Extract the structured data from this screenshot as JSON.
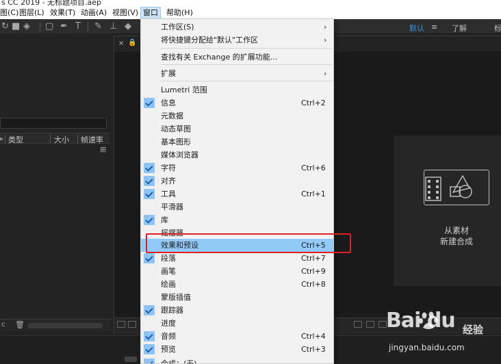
{
  "titlebar": {
    "text": "s CC 2019 - 无标题项目.aep"
  },
  "menubar": {
    "items": [
      "图(C)",
      "图层(L)",
      "效果(T)",
      "动画(A)",
      "视图(V)",
      "窗口",
      "帮助(H)"
    ],
    "active_index": 5
  },
  "toolbar": {
    "workspaces": [
      "默认",
      "≡",
      "了解",
      "标"
    ],
    "active_workspace": "默认"
  },
  "project_panel": {
    "columns": [
      "类型",
      "大小",
      "帧速率"
    ],
    "footer_label": "c"
  },
  "composition": {
    "card_line1": "从素材",
    "card_line2": "新建合成"
  },
  "window_menu": {
    "items": [
      {
        "label": "工作区(S)",
        "shortcut": "",
        "checked": false,
        "submenu": true
      },
      {
        "label": "将快捷键分配给\"默认\"工作区",
        "shortcut": "",
        "checked": false,
        "submenu": true
      },
      {
        "label": "查找有关 Exchange 的扩展功能...",
        "shortcut": "",
        "checked": false,
        "submenu": false
      },
      {
        "label": "扩展",
        "shortcut": "",
        "checked": false,
        "submenu": true
      },
      {
        "label": "Lumetri 范围",
        "shortcut": "",
        "checked": false,
        "submenu": false
      },
      {
        "label": "信息",
        "shortcut": "Ctrl+2",
        "checked": true,
        "submenu": false
      },
      {
        "label": "元数据",
        "shortcut": "",
        "checked": false,
        "submenu": false
      },
      {
        "label": "动态草图",
        "shortcut": "",
        "checked": false,
        "submenu": false
      },
      {
        "label": "基本图形",
        "shortcut": "",
        "checked": false,
        "submenu": false
      },
      {
        "label": "媒体浏览器",
        "shortcut": "",
        "checked": false,
        "submenu": false
      },
      {
        "label": "字符",
        "shortcut": "Ctrl+6",
        "checked": true,
        "submenu": false
      },
      {
        "label": "对齐",
        "shortcut": "",
        "checked": true,
        "submenu": false
      },
      {
        "label": "工具",
        "shortcut": "Ctrl+1",
        "checked": true,
        "submenu": false
      },
      {
        "label": "平滑器",
        "shortcut": "",
        "checked": false,
        "submenu": false
      },
      {
        "label": "库",
        "shortcut": "",
        "checked": true,
        "submenu": false
      },
      {
        "label": "摇摆器",
        "shortcut": "",
        "checked": false,
        "submenu": false
      },
      {
        "label": "效果和预设",
        "shortcut": "Ctrl+5",
        "checked": false,
        "submenu": false,
        "highlighted": true
      },
      {
        "label": "段落",
        "shortcut": "Ctrl+7",
        "checked": true,
        "submenu": false
      },
      {
        "label": "画笔",
        "shortcut": "Ctrl+9",
        "checked": false,
        "submenu": false
      },
      {
        "label": "绘画",
        "shortcut": "Ctrl+8",
        "checked": false,
        "submenu": false
      },
      {
        "label": "蒙版插值",
        "shortcut": "",
        "checked": false,
        "submenu": false
      },
      {
        "label": "跟踪器",
        "shortcut": "",
        "checked": true,
        "submenu": false
      },
      {
        "label": "进度",
        "shortcut": "",
        "checked": false,
        "submenu": false
      },
      {
        "label": "音频",
        "shortcut": "Ctrl+4",
        "checked": true,
        "submenu": false
      },
      {
        "label": "预览",
        "shortcut": "Ctrl+3",
        "checked": true,
        "submenu": false
      },
      {
        "label": "合成：(无)",
        "shortcut": "",
        "checked": true,
        "submenu": false
      }
    ]
  },
  "watermark": {
    "logo": "Bai  du",
    "logo_cn": "经验",
    "url": "jingyan.baidu.com"
  },
  "colors": {
    "accent": "#3d8fe0",
    "menu_highlight": "#91c9f7",
    "annotation_red": "#e02020"
  }
}
